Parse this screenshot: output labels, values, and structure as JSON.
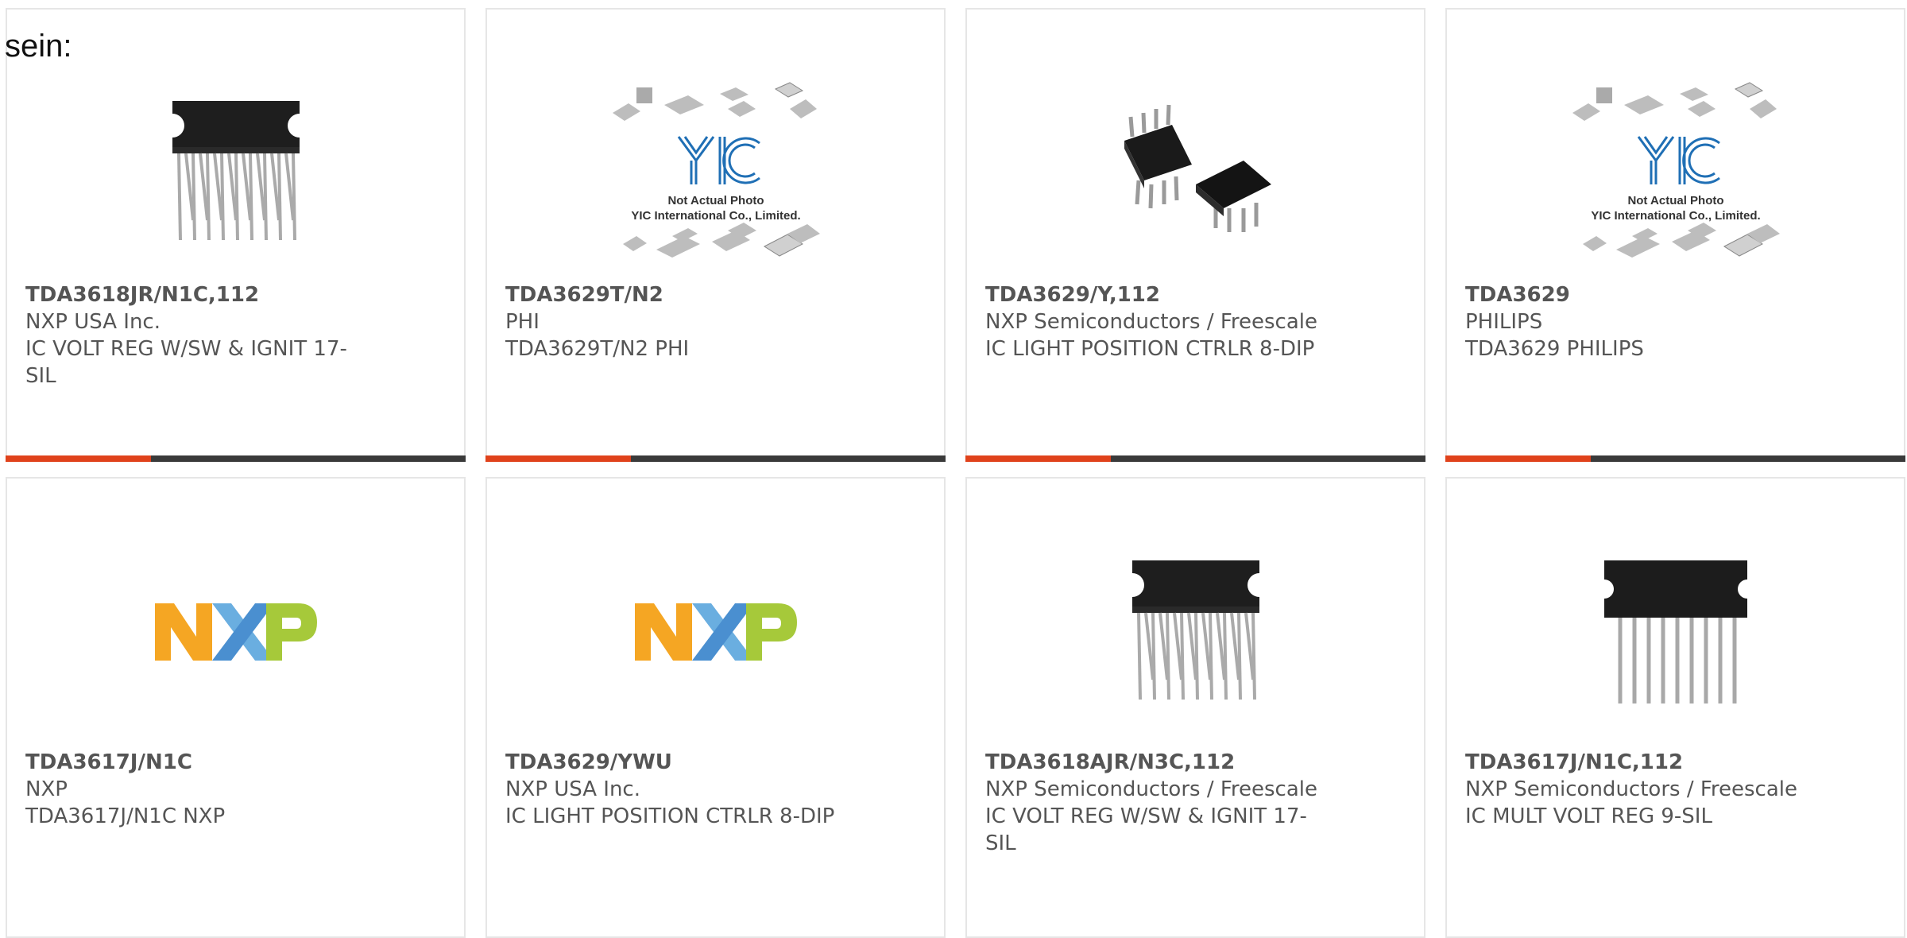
{
  "intro_text": "sein:",
  "accent_color": "#e0421b",
  "bar_color": "#3a3a3a",
  "placeholder": {
    "line1": "Not Actual Photo",
    "line2": "YIC International Co., Limited."
  },
  "products": [
    {
      "part": "TDA3618JR/N1C,112",
      "maker": "NXP USA Inc.",
      "desc": "IC VOLT REG W/SW & IGNIT 17-SIL",
      "image": "chip-17sil-icon"
    },
    {
      "part": "TDA3629T/N2",
      "maker": "PHI",
      "desc": "TDA3629T/N2 PHI",
      "image": "yic-placeholder"
    },
    {
      "part": "TDA3629/Y,112",
      "maker": "NXP Semiconductors / Freescale",
      "desc": "IC LIGHT POSITION CTRLR 8-DIP",
      "image": "chip-8dip-icon"
    },
    {
      "part": "TDA3629",
      "maker": "PHILIPS",
      "desc": "TDA3629 PHILIPS",
      "image": "yic-placeholder"
    },
    {
      "part": "TDA3617J/N1C",
      "maker": "NXP",
      "desc": "TDA3617J/N1C NXP",
      "image": "nxp-logo"
    },
    {
      "part": "TDA3629/YWU",
      "maker": "NXP USA Inc.",
      "desc": "IC LIGHT POSITION CTRLR 8-DIP",
      "image": "nxp-logo"
    },
    {
      "part": "TDA3618AJR/N3C,112",
      "maker": "NXP Semiconductors / Freescale",
      "desc": "IC VOLT REG W/SW & IGNIT 17-SIL",
      "image": "chip-17sil-icon"
    },
    {
      "part": "TDA3617J/N1C,112",
      "maker": "NXP Semiconductors / Freescale",
      "desc": "IC MULT VOLT REG 9-SIL",
      "image": "chip-9sil-icon"
    }
  ]
}
